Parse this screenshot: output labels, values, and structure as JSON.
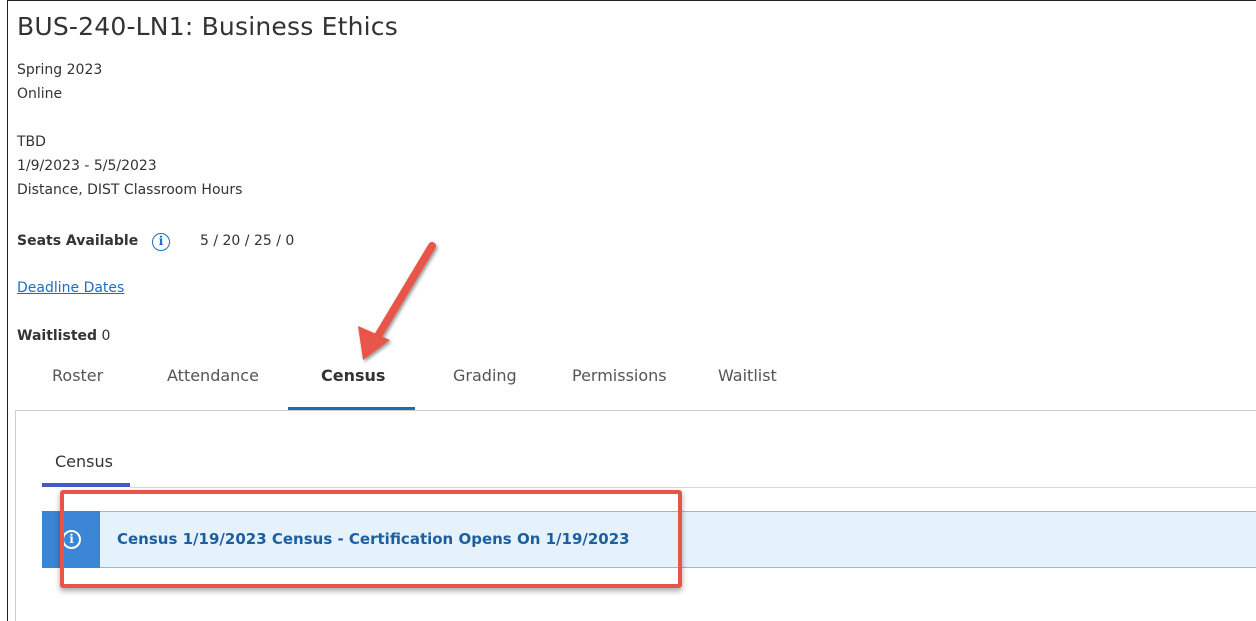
{
  "course": {
    "title": "BUS-240-LN1: Business Ethics",
    "term": "Spring 2023",
    "mode": "Online",
    "instructor": "TBD",
    "dates": "1/9/2023 - 5/5/2023",
    "location": "Distance, DIST Classroom Hours",
    "seats_label": "Seats Available",
    "seats_value": "5 / 20 / 25 / 0",
    "deadline_link": "Deadline Dates",
    "waitlisted_label": "Waitlisted",
    "waitlisted_value": "0"
  },
  "tabs": [
    {
      "label": "Roster"
    },
    {
      "label": "Attendance"
    },
    {
      "label": "Census"
    },
    {
      "label": "Grading"
    },
    {
      "label": "Permissions"
    },
    {
      "label": "Waitlist"
    }
  ],
  "active_tab": "Census",
  "subtab": {
    "label": "Census"
  },
  "alert": {
    "icon": "info-icon",
    "text": "Census 1/19/2023 Census - Certification Opens On 1/19/2023"
  },
  "annotation": {
    "arrow_color": "#e8544a",
    "highlight_color": "#e8544a"
  },
  "colors": {
    "accent": "#1a6fc4",
    "tab_underline": "#1a6fb0",
    "subtab_underline": "#4a57c9",
    "alert_bg": "#e6f2fb",
    "alert_bar": "#3a86d4"
  }
}
